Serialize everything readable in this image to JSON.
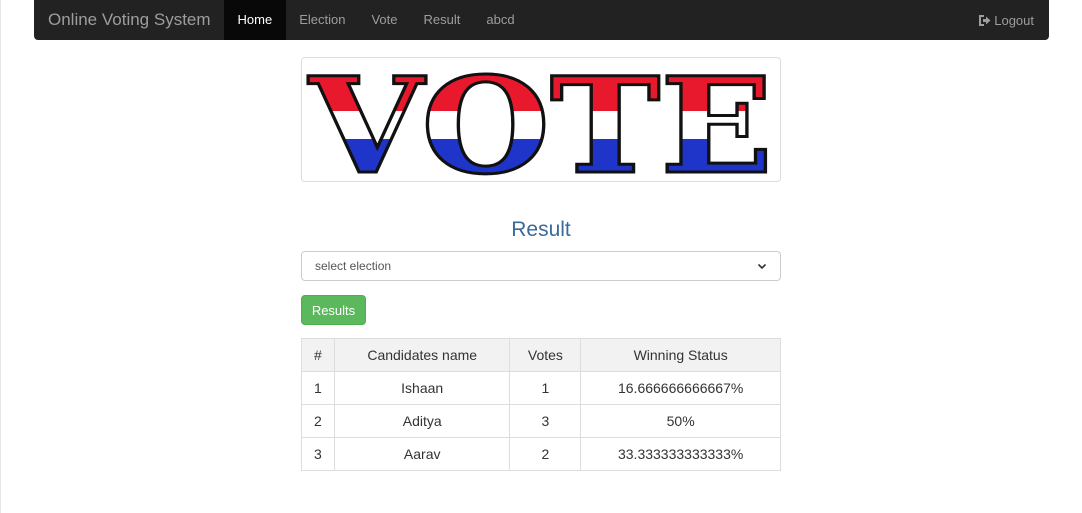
{
  "navbar": {
    "brand": "Online Voting System",
    "items": [
      {
        "label": "Home",
        "active": true
      },
      {
        "label": "Election",
        "active": false
      },
      {
        "label": "Vote",
        "active": false
      },
      {
        "label": "Result",
        "active": false
      },
      {
        "label": "abcd",
        "active": false
      }
    ],
    "logout_label": "Logout",
    "logout_icon": "logout-icon"
  },
  "banner": {
    "text": "VOTE",
    "colors": {
      "red": "#e8192c",
      "white": "#ffffff",
      "blue": "#1f34c9",
      "outline": "#111111"
    }
  },
  "result": {
    "title": "Result",
    "select_value": "select election",
    "button_label": "Results"
  },
  "table": {
    "headers": [
      "#",
      "Candidates name",
      "Votes",
      "Winning Status"
    ],
    "rows": [
      {
        "num": "1",
        "name": "Ishaan",
        "votes": "1",
        "status": "16.666666666667%"
      },
      {
        "num": "2",
        "name": "Aditya",
        "votes": "3",
        "status": "50%"
      },
      {
        "num": "3",
        "name": "Aarav",
        "votes": "2",
        "status": "33.333333333333%"
      }
    ]
  },
  "colors": {
    "navbar_bg": "#222222",
    "nav_active_bg": "#080808",
    "title": "#3a6a9a",
    "success": "#5cb85c"
  }
}
